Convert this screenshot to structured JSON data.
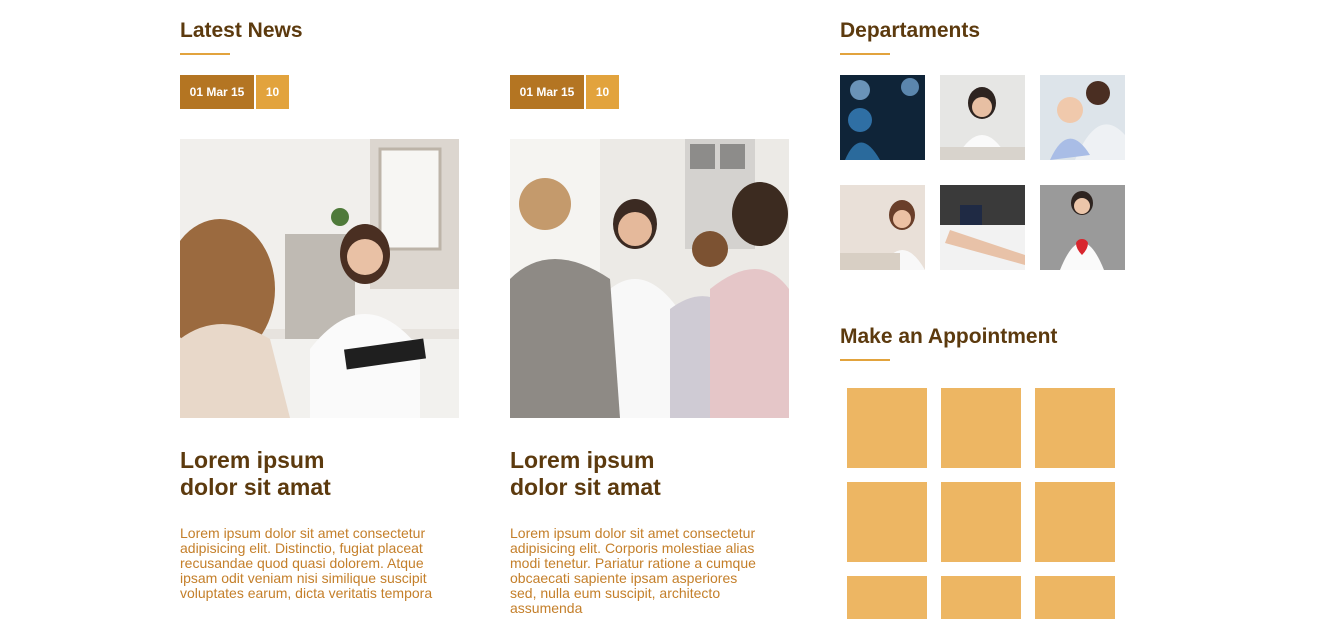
{
  "news": {
    "heading": "Latest News",
    "items": [
      {
        "date": "01 Mar 15",
        "count": "10",
        "title_line1": "Lorem ipsum",
        "title_line2": "dolor sit amat",
        "body": "Lorem ipsum dolor sit amet consectetur adipisicing elit. Distinctio, fugiat placeat recusandae quod quasi dolorem. Atque ipsam odit veniam nisi similique suscipit voluptates earum, dicta veritatis tempora"
      },
      {
        "date": "01 Mar 15",
        "count": "10",
        "title_line1": "Lorem ipsum",
        "title_line2": "dolor sit amat",
        "body": "Lorem ipsum dolor sit amet consectetur adipisicing elit. Corporis molestiae alias modi tenetur. Pariatur ratione a cumque obcaecati sapiente ipsam asperiores sed, nulla eum suscipit, architecto assumenda"
      }
    ]
  },
  "departments": {
    "heading": "Departaments"
  },
  "appointment": {
    "heading": "Make an Appointment"
  },
  "colors": {
    "heading": "#5c3a0e",
    "accent": "#e2a33d",
    "date_badge": "#b47522",
    "appointment_tile": "#edb663"
  }
}
